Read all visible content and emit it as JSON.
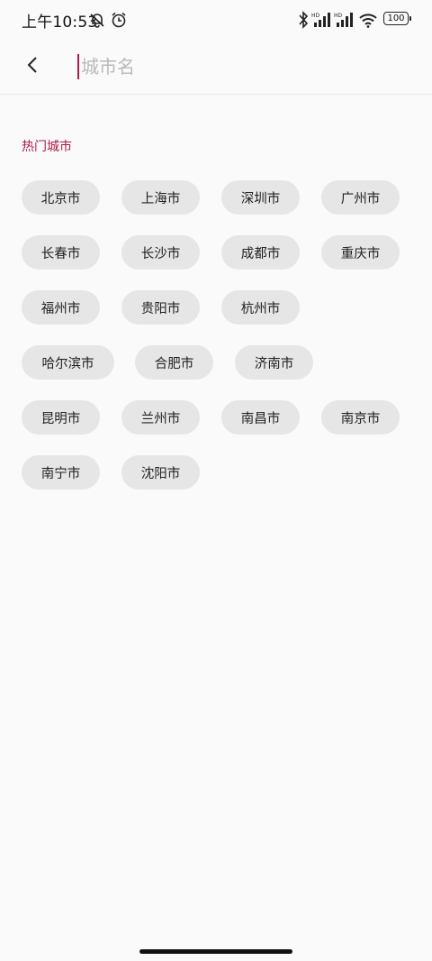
{
  "status_bar": {
    "time": "上午10:53",
    "battery": "100",
    "icons": [
      "mute-bell-icon",
      "alarm-icon",
      "bluetooth-icon",
      "signal-hd-icon",
      "signal-hd-icon",
      "wifi-icon",
      "battery-icon"
    ]
  },
  "header": {
    "back_icon": "back-arrow-icon",
    "search_placeholder": "城市名",
    "search_value": ""
  },
  "hot_cities": {
    "title": "热门城市",
    "items": [
      "北京市",
      "上海市",
      "深圳市",
      "广州市",
      "长春市",
      "长沙市",
      "成都市",
      "重庆市",
      "福州市",
      "贵阳市",
      "杭州市",
      "哈尔滨市",
      "合肥市",
      "济南市",
      "昆明市",
      "兰州市",
      "南昌市",
      "南京市",
      "南宁市",
      "沈阳市"
    ]
  },
  "colors": {
    "accent": "#b01a44",
    "chip_bg": "#e6e6e6",
    "background": "#fafafa"
  }
}
